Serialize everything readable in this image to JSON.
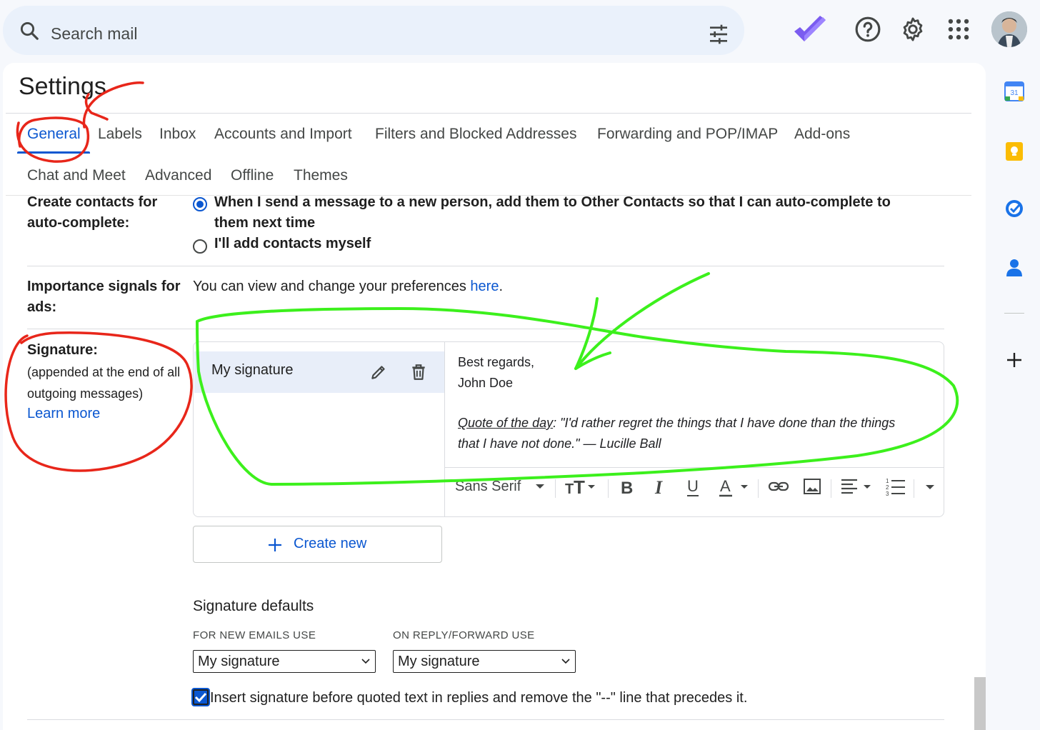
{
  "search": {
    "placeholder": "Search mail"
  },
  "header_icons": [
    "tasks-logo-icon",
    "help-icon",
    "settings-gear-icon",
    "apps-grid-icon",
    "avatar"
  ],
  "settings": {
    "title": "Settings",
    "tabs_row1": [
      "General",
      "Labels",
      "Inbox",
      "Accounts and Import",
      "Filters and Blocked Addresses",
      "Forwarding and POP/IMAP",
      "Add-ons"
    ],
    "tabs_row2": [
      "Chat and Meet",
      "Advanced",
      "Offline",
      "Themes"
    ],
    "active_tab": "General"
  },
  "contacts": {
    "label_line1": "Create contacts for",
    "label_line2": "auto-complete:",
    "option1_line1": "When I send a message to a new person, add them to Other Contacts so that I can auto-complete to",
    "option1_line2": "them next time",
    "option2": "I'll add contacts myself"
  },
  "importance": {
    "label_line1": "Importance signals for",
    "label_line2": "ads:",
    "text": "You can view and change your preferences ",
    "link": "here",
    "end": "."
  },
  "signature": {
    "label": "Signature:",
    "desc_line1": "(appended at the end of all",
    "desc_line2": "outgoing messages)",
    "learn_more": "Learn more",
    "item_name": "My signature",
    "body_line1": "Best regards,",
    "body_line2": "John Doe",
    "quote_label": "Quote of the day",
    "quote_colon": ": ",
    "quote_line1": "\"I'd rather regret the things that I have done than the things",
    "quote_line2": "that I have not done.\" — Lucille Ball",
    "font_select": "Sans Serif",
    "create_new": "Create new"
  },
  "defaults": {
    "heading": "Signature defaults",
    "new_label": "FOR NEW EMAILS USE",
    "reply_label": "ON REPLY/FORWARD USE",
    "new_value": "My signature",
    "reply_value": "My signature",
    "insert_checkbox": "Insert signature before quoted text in replies and remove the \"--\" line that precedes it.",
    "insert_checked": true
  },
  "rail": {
    "calendar_day": "31"
  },
  "colors": {
    "accent": "#0b57d0",
    "annotation_red": "#e8261a",
    "annotation_green": "#3cf01c"
  }
}
